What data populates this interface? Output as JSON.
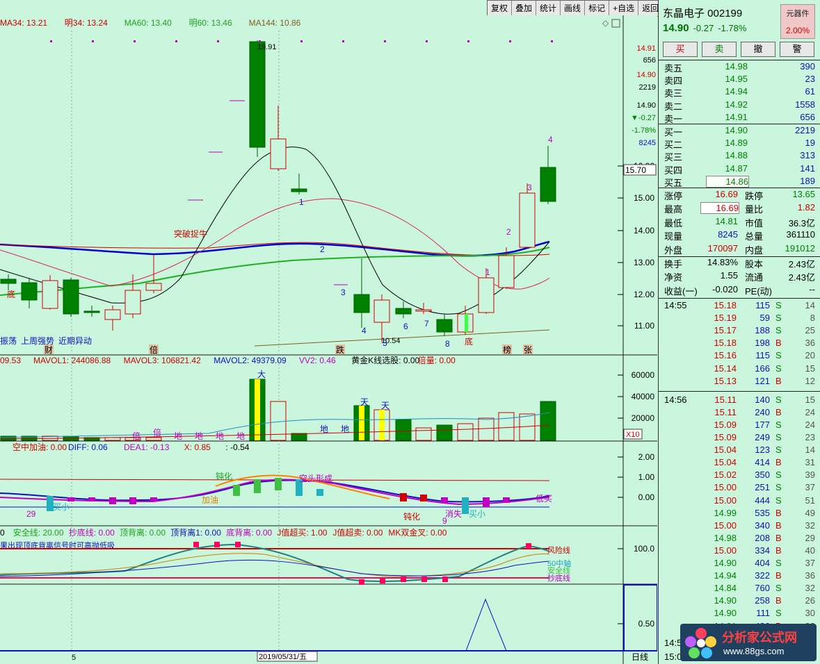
{
  "toolbar": {
    "items": [
      "复权",
      "叠加",
      "统计",
      "画线",
      "标记",
      "+自选",
      "返回"
    ]
  },
  "main": {
    "ma_line": [
      {
        "text": "MA34: 13.21",
        "color": "#d00000"
      },
      {
        "text": "明34: 13.24",
        "color": "#d00000"
      },
      {
        "text": "MA60: 13.40",
        "color": "#20a020"
      },
      {
        "text": "明60: 13.46",
        "color": "#20a020"
      },
      {
        "text": "MA144: 10.86",
        "color": "#806020"
      }
    ],
    "high_label": "19.91",
    "low_label": "10.54",
    "breakout_label": "突破捉牛",
    "bottom_labels": [
      "振荡",
      "上周强势",
      "近期异动"
    ],
    "left_label": "底",
    "wave_numbers": [
      "1",
      "2",
      "3",
      "4",
      "5",
      "6",
      "7",
      "8",
      "9"
    ],
    "rise_numbers": [
      "1",
      "2",
      "3",
      "4"
    ],
    "bottom_mark": "底",
    "marks": [
      "财",
      "倍",
      "跌",
      "榜",
      "张"
    ],
    "y_axis": [
      "16.00",
      "15.00",
      "14.00",
      "13.00",
      "12.00",
      "11.00"
    ],
    "right_tags": [
      "14.91",
      "656",
      "14.90",
      "2219",
      "14.90",
      "▼-0.27",
      "-1.78%",
      "8245"
    ],
    "cursor_price": "15.70"
  },
  "vol": {
    "header": [
      {
        "text": "09.53",
        "color": "#d00000"
      },
      {
        "text": "MAVOL1: 244086.88",
        "color": "#d00000"
      },
      {
        "text": "MAVOL3: 106821.42",
        "color": "#d00000"
      },
      {
        "text": "MAVOL2: 49379.09",
        "color": "#1010c0"
      },
      {
        "text": "VV2: 0.46",
        "color": "#c000c0"
      },
      {
        "text": "黄金K线选股: 0.00",
        "color": "#000000"
      },
      {
        "text": "倍量: 0.00",
        "color": "#d00000"
      }
    ],
    "y_axis": [
      "60000",
      "40000",
      "20000"
    ],
    "unit": "X10",
    "labels": [
      "大",
      "天",
      "天",
      "地",
      "地",
      "倍",
      "倍",
      "地",
      "地",
      "地",
      "地"
    ]
  },
  "macd": {
    "header": [
      {
        "text": "空中加油: 0.00",
        "color": "#d00000"
      },
      {
        "text": "DIFF: 0.06",
        "color": "#1010c0"
      },
      {
        "text": "DEA1: -0.13",
        "color": "#c000c0"
      },
      {
        "text": "X: 0.85",
        "color": "#d00000"
      },
      {
        "text": ": -0.54",
        "color": "#000000"
      }
    ],
    "y_axis": [
      "2.00",
      "1.00",
      "0.00"
    ],
    "labels": [
      "钝化",
      "钝化",
      "加油",
      "买小",
      "29",
      "空头形成",
      "钝化",
      "消失",
      "买小",
      "9",
      "低买"
    ]
  },
  "kdj": {
    "header": [
      {
        "text": "0",
        "color": "#000000"
      },
      {
        "text": "安全线: 20.00",
        "color": "#20a020"
      },
      {
        "text": "抄底线: 0.00",
        "color": "#c000c0"
      },
      {
        "text": "顶背离: 0.00",
        "color": "#20a020"
      },
      {
        "text": "顶背离1: 0.00",
        "color": "#1010c0"
      },
      {
        "text": "底背离: 0.00",
        "color": "#c000c0"
      },
      {
        "text": "J值超买: 1.00",
        "color": "#d00000"
      },
      {
        "text": "J值超卖: 0.00",
        "color": "#d00000"
      },
      {
        "text": "MK双金叉: 0.00",
        "color": "#d00000"
      }
    ],
    "note": "果出现顶底背离信号时可高抛低吸",
    "y_axis": [
      "100.0"
    ],
    "line_labels": [
      "风险线",
      "50中轴",
      "安全线",
      "抄底线"
    ]
  },
  "bottom": {
    "y_axis": [
      "0.50"
    ],
    "x_labels": [
      "5",
      "2019/05/31/五"
    ],
    "period": "日线"
  },
  "quote": {
    "name": "东晶电子 002199",
    "badge_title": "元器件",
    "badge_value": "2.00%",
    "price": "14.90",
    "change": "-0.27",
    "pct": "-1.78%",
    "buttons": [
      "买",
      "卖",
      "撤",
      "警"
    ],
    "asks": [
      {
        "label": "卖五",
        "price": "14.98",
        "vol": "390"
      },
      {
        "label": "卖四",
        "price": "14.95",
        "vol": "23"
      },
      {
        "label": "卖三",
        "price": "14.94",
        "vol": "61"
      },
      {
        "label": "卖二",
        "price": "14.92",
        "vol": "1558"
      },
      {
        "label": "卖一",
        "price": "14.91",
        "vol": "656"
      }
    ],
    "bids": [
      {
        "label": "买一",
        "price": "14.90",
        "vol": "2219"
      },
      {
        "label": "买二",
        "price": "14.89",
        "vol": "19"
      },
      {
        "label": "买三",
        "price": "14.88",
        "vol": "313"
      },
      {
        "label": "买四",
        "price": "14.87",
        "vol": "141"
      },
      {
        "label": "买五",
        "price": "14.86",
        "vol": "189"
      }
    ],
    "stats": [
      {
        "k1": "涨停",
        "v1": "16.69",
        "c1": "red",
        "k2": "跌停",
        "v2": "13.65",
        "c2": "grn"
      },
      {
        "k1": "最高",
        "v1": "16.69",
        "c1": "red",
        "k2": "量比",
        "v2": "1.82",
        "c2": "red"
      },
      {
        "k1": "最低",
        "v1": "14.81",
        "c1": "grn",
        "k2": "市值",
        "v2": "36.3亿",
        "c2": ""
      },
      {
        "k1": "现量",
        "v1": "8245",
        "c1": "blu",
        "k2": "总量",
        "v2": "361110",
        "c2": ""
      },
      {
        "k1": "外盘",
        "v1": "170097",
        "c1": "red",
        "k2": "内盘",
        "v2": "191012",
        "c2": "grn"
      }
    ],
    "stats2": [
      {
        "k1": "换手",
        "v1": "14.83%",
        "c1": "",
        "k2": "股本",
        "v2": "2.43亿",
        "c2": ""
      },
      {
        "k1": "净资",
        "v1": "1.55",
        "c1": "",
        "k2": "流通",
        "v2": "2.43亿",
        "c2": ""
      },
      {
        "k1": "收益(一)",
        "v1": "-0.020",
        "c1": "",
        "k2": "PE(动)",
        "v2": "--",
        "c2": ""
      }
    ],
    "ticks": [
      {
        "t": "14:55",
        "p": "15.18",
        "c": "red",
        "v": "115",
        "s": "S",
        "n": "14"
      },
      {
        "t": "",
        "p": "15.19",
        "c": "red",
        "v": "59",
        "s": "S",
        "n": "8"
      },
      {
        "t": "",
        "p": "15.17",
        "c": "red",
        "v": "188",
        "s": "S",
        "n": "25"
      },
      {
        "t": "",
        "p": "15.18",
        "c": "red",
        "v": "198",
        "s": "B",
        "n": "36"
      },
      {
        "t": "",
        "p": "15.16",
        "c": "red",
        "v": "115",
        "s": "S",
        "n": "20"
      },
      {
        "t": "",
        "p": "15.14",
        "c": "red",
        "v": "166",
        "s": "S",
        "n": "15"
      },
      {
        "t": "",
        "p": "15.13",
        "c": "red",
        "v": "121",
        "s": "B",
        "n": "12"
      },
      {
        "t": "14:56",
        "p": "15.11",
        "c": "red",
        "v": "140",
        "s": "S",
        "n": "15"
      },
      {
        "t": "",
        "p": "15.11",
        "c": "red",
        "v": "240",
        "s": "B",
        "n": "24"
      },
      {
        "t": "",
        "p": "15.09",
        "c": "red",
        "v": "177",
        "s": "S",
        "n": "24"
      },
      {
        "t": "",
        "p": "15.09",
        "c": "red",
        "v": "249",
        "s": "S",
        "n": "23"
      },
      {
        "t": "",
        "p": "15.04",
        "c": "red",
        "v": "123",
        "s": "S",
        "n": "14"
      },
      {
        "t": "",
        "p": "15.04",
        "c": "red",
        "v": "414",
        "s": "B",
        "n": "31"
      },
      {
        "t": "",
        "p": "15.02",
        "c": "red",
        "v": "350",
        "s": "S",
        "n": "39"
      },
      {
        "t": "",
        "p": "15.00",
        "c": "red",
        "v": "251",
        "s": "S",
        "n": "37"
      },
      {
        "t": "",
        "p": "15.00",
        "c": "red",
        "v": "444",
        "s": "S",
        "n": "51"
      },
      {
        "t": "",
        "p": "14.99",
        "c": "grn",
        "v": "535",
        "s": "B",
        "n": "49"
      },
      {
        "t": "",
        "p": "15.00",
        "c": "red",
        "v": "340",
        "s": "B",
        "n": "32"
      },
      {
        "t": "",
        "p": "14.98",
        "c": "grn",
        "v": "208",
        "s": "B",
        "n": "29"
      },
      {
        "t": "",
        "p": "15.00",
        "c": "red",
        "v": "334",
        "s": "B",
        "n": "40"
      },
      {
        "t": "",
        "p": "14.90",
        "c": "grn",
        "v": "404",
        "s": "S",
        "n": "37"
      },
      {
        "t": "",
        "p": "14.94",
        "c": "grn",
        "v": "322",
        "s": "B",
        "n": "36"
      },
      {
        "t": "",
        "p": "14.84",
        "c": "grn",
        "v": "760",
        "s": "S",
        "n": "32"
      },
      {
        "t": "",
        "p": "14.90",
        "c": "grn",
        "v": "258",
        "s": "B",
        "n": "26"
      },
      {
        "t": "",
        "p": "14.90",
        "c": "grn",
        "v": "111",
        "s": "S",
        "n": "30"
      },
      {
        "t": "",
        "p": "14.91",
        "c": "grn",
        "v": "436",
        "s": "B",
        "n": "32"
      }
    ],
    "bottom_times": [
      "14:5",
      "15:00"
    ]
  },
  "watermark": {
    "title": "分析家公式网",
    "url": "www.88gs.com"
  }
}
